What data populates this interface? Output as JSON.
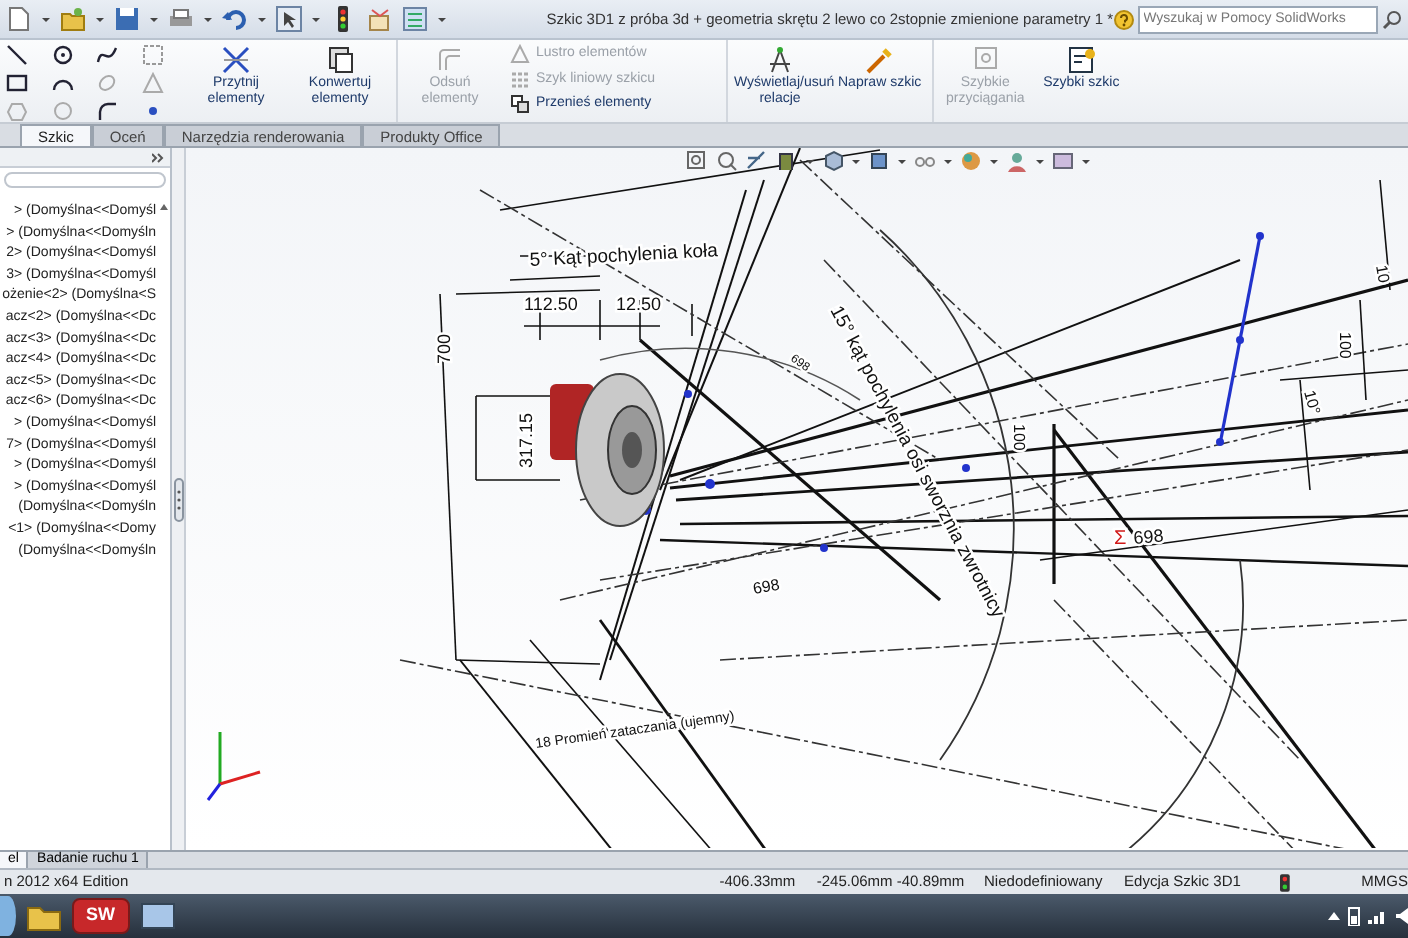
{
  "window": {
    "title": "Szkic 3D1 z próba 3d + geometria skrętu 2 lewo co 2stopnie zmienione parametry 1 *"
  },
  "search": {
    "placeholder": "Wyszukaj w Pomocy SolidWorks"
  },
  "ribbon": {
    "commands": [
      {
        "kind": "large",
        "label": "Przytnij elementy",
        "disabled": false
      },
      {
        "kind": "large",
        "label": "Konwertuj elementy",
        "disabled": false
      },
      {
        "kind": "large",
        "label": "Odsuń elementy",
        "disabled": true
      },
      {
        "kind": "small",
        "label": "Lustro elementów",
        "disabled": true
      },
      {
        "kind": "small",
        "label": "Szyk liniowy szkicu",
        "disabled": true
      },
      {
        "kind": "small",
        "label": "Przenieś elementy",
        "disabled": false
      },
      {
        "kind": "large",
        "label": "Wyświetlaj/usuń relacje",
        "disabled": false
      },
      {
        "kind": "large",
        "label": "Napraw szkic",
        "disabled": false
      },
      {
        "kind": "large",
        "label": "Szybkie przyciągania",
        "disabled": true
      },
      {
        "kind": "large",
        "label": "Szybki szkic",
        "disabled": false
      }
    ]
  },
  "tabs": [
    {
      "label": "Szkic",
      "selected": true
    },
    {
      "label": "Oceń",
      "selected": false
    },
    {
      "label": "Narzędzia renderowania",
      "selected": false
    },
    {
      "label": "Produkty Office",
      "selected": false
    }
  ],
  "feature_tree": {
    "items": [
      "> (Domyślna<<Domyśl",
      "> (Domyślna<<Domyśln",
      "2> (Domyślna<<Domyśl",
      "3> (Domyślna<<Domyśl",
      "ożenie<2> (Domyślna<S",
      "acz<2> (Domyślna<<Dc",
      "acz<3> (Domyślna<<Dc",
      "acz<4> (Domyślna<<Dc",
      "acz<5> (Domyślna<<Dc",
      "acz<6> (Domyślna<<Dc",
      "> (Domyślna<<Domyśl",
      "7> (Domyślna<<Domyśl",
      "> (Domyślna<<Domyśl",
      "> (Domyślna<<Domyśl",
      "(Domyślna<<Domyśln",
      "<1> (Domyślna<<Domy",
      "(Domyślna<<Domyśln"
    ]
  },
  "canvas": {
    "labels": [
      {
        "kind": "note",
        "text": "5° Kąt pochylenia koła"
      },
      {
        "kind": "dimension",
        "text": "700"
      },
      {
        "kind": "dimension",
        "text": "112.50"
      },
      {
        "kind": "dimension",
        "text": "12.50"
      },
      {
        "kind": "dimension",
        "text": "317.15"
      },
      {
        "kind": "note",
        "text": "15° kąt pochylenia osi sworznia zwrotnicy"
      },
      {
        "kind": "dimension",
        "text": "698"
      },
      {
        "kind": "dimension",
        "text": "698"
      },
      {
        "kind": "equation",
        "text": "Σ"
      },
      {
        "kind": "dimension",
        "text": "698"
      },
      {
        "kind": "dimension",
        "text": "100"
      },
      {
        "kind": "dimension",
        "text": "100"
      },
      {
        "kind": "dimension",
        "text": "10°"
      },
      {
        "kind": "dimension",
        "text": "10"
      },
      {
        "kind": "note",
        "text": "18 Promień zataczania (ujemny)"
      }
    ]
  },
  "bottom_tabs": [
    {
      "label": "el",
      "selected": true
    },
    {
      "label": "Badanie ruchu 1",
      "selected": false
    }
  ],
  "status_bar": [
    "n 2012 x64 Edition",
    "-406.33mm",
    "-245.06mm -40.89mm",
    "Niedodefiniowany",
    "Edycja Szkic 3D1",
    "MMGS"
  ],
  "taskbar": {
    "apps": [
      {
        "label": "SW"
      }
    ]
  }
}
